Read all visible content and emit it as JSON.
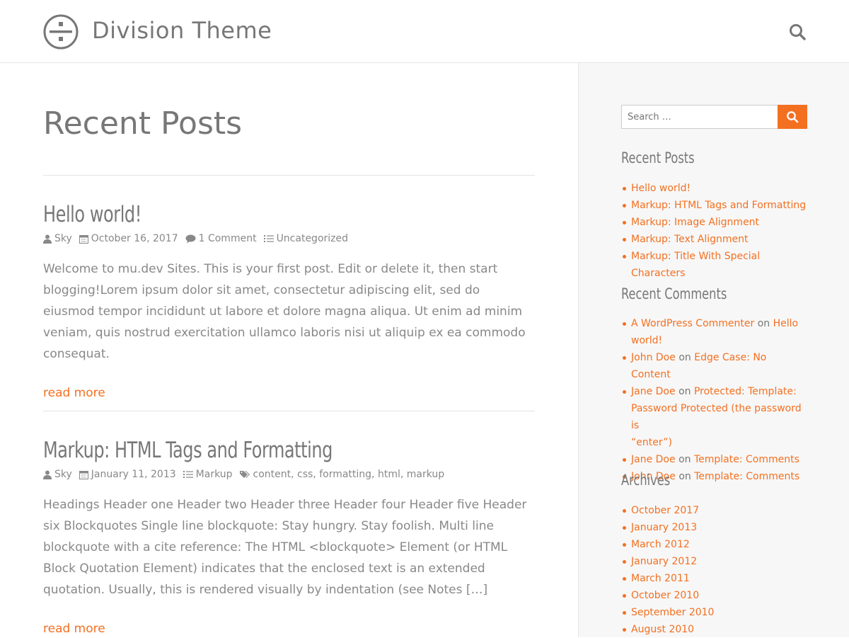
{
  "header": {
    "site_title": "Division Theme",
    "icons": {
      "logo": "division-sign-logo",
      "search": "search-icon"
    }
  },
  "main": {
    "page_title": "Recent Posts",
    "posts": [
      {
        "title": "Hello world!",
        "author": "Sky",
        "date": "October 16, 2017",
        "comments": "1 Comment",
        "category": "Uncategorized",
        "excerpt": "Welcome to mu.dev Sites. This is your first post. Edit or delete it, then start blogging!Lorem ipsum dolor sit amet, consectetur adipiscing elit, sed do eiusmod tempor incididunt ut labore et dolore magna aliqua. Ut enim ad minim veniam, quis nostrud exercitation ullamco laboris nisi ut aliquip ex ea commodo consequat.",
        "read_more": "read more"
      },
      {
        "title": "Markup: HTML Tags and Formatting",
        "author": "Sky",
        "date": "January 11, 2013",
        "category": "Markup",
        "tags": "content, css, formatting, html, markup",
        "excerpt": "Headings Header one Header two Header three Header four Header five Header six Blockquotes Single line blockquote: Stay hungry. Stay foolish. Multi line blockquote with a cite reference: The HTML <blockquote> Element (or HTML Block Quotation Element) indicates that the enclosed text is an extended quotation. Usually, this is rendered visually by indentation (see Notes […]",
        "read_more": "read more"
      }
    ]
  },
  "sidebar": {
    "search": {
      "placeholder": "Search …"
    },
    "recent_posts": {
      "title": "Recent Posts",
      "items": [
        "Hello world!",
        "Markup: HTML Tags and Formatting",
        "Markup: Image Alignment",
        "Markup: Text Alignment",
        "Markup: Title With Special Characters"
      ]
    },
    "recent_comments": {
      "title": "Recent Comments",
      "on": "on",
      "items": [
        {
          "author": "A WordPress Commenter",
          "post_line1": "Hello",
          "post_line2": "world!"
        },
        {
          "author": "John Doe",
          "post": "Edge Case: No Content"
        },
        {
          "author": "Jane Doe",
          "post_line1": "Protected: Template:",
          "post_line2": "Password Protected (the password is",
          "post_line3": "“enter”)"
        },
        {
          "author": "Jane Doe",
          "post": "Template: Comments"
        },
        {
          "author": "John Doe",
          "post": "Template: Comments"
        }
      ]
    },
    "archives": {
      "title": "Archives",
      "items": [
        "October 2017",
        "January 2013",
        "March 2012",
        "January 2012",
        "March 2011",
        "October 2010",
        "September 2010",
        "August 2010"
      ]
    }
  },
  "colors": {
    "accent": "#f37021",
    "text": "#777777",
    "sidebar_bg": "#f7f7f7"
  }
}
